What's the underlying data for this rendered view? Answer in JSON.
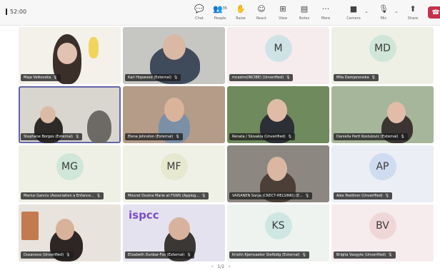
{
  "toolbar": {
    "timer": "52:00",
    "buttons": [
      {
        "label": "Chat",
        "icon": "chat-icon",
        "glyph": "💬"
      },
      {
        "label": "People",
        "icon": "people-icon",
        "glyph": "👥",
        "badge": "35"
      },
      {
        "label": "Raise",
        "icon": "raise-hand-icon",
        "glyph": "✋"
      },
      {
        "label": "React",
        "icon": "react-icon",
        "glyph": "☺"
      },
      {
        "label": "View",
        "icon": "view-icon",
        "glyph": "⊞"
      },
      {
        "label": "Notes",
        "icon": "notes-icon",
        "glyph": "▤"
      },
      {
        "label": "More",
        "icon": "more-icon",
        "glyph": "···"
      },
      {
        "label": "Camera",
        "icon": "camera-icon",
        "glyph": "■"
      },
      {
        "label": "Mic",
        "icon": "mic-muted-icon",
        "glyph": "🎙"
      },
      {
        "label": "Share",
        "icon": "share-icon",
        "glyph": "⬆"
      }
    ],
    "leave_glyph": "☎"
  },
  "participants": [
    {
      "name": "Maja Velkovska",
      "type": "video"
    },
    {
      "name": "Karl Hopwood (External)",
      "type": "video"
    },
    {
      "name": "mcastro(INCIBE) (Unverified)",
      "type": "avatar",
      "initials": "M",
      "bg": "#cfe3e6"
    },
    {
      "name": "Mila Damjanovska",
      "type": "avatar",
      "initials": "MD",
      "bg": "#cfe6d8"
    },
    {
      "name": "Stephane Borges (External)",
      "type": "video"
    },
    {
      "name": "Elena Johnston (External)",
      "type": "video"
    },
    {
      "name": "Renata / Slovakia (Unverified)",
      "type": "video"
    },
    {
      "name": "Daniella Pertl Kostulovic (External)",
      "type": "video"
    },
    {
      "name": "Marius Ganciu (Association a Enfance...",
      "type": "avatar",
      "initials": "MG",
      "bg": "#cfe6d8"
    },
    {
      "name": "Mourat Dusina Marie at FSWS (Applog...",
      "type": "avatar",
      "initials": "MF",
      "bg": "#e6e8cf"
    },
    {
      "name": "VAISANEN Sonja (CNECT-HELSINKI) (E...",
      "type": "video"
    },
    {
      "name": "Alex Poettner (Unverified)",
      "type": "avatar",
      "initials": "AP",
      "bg": "#cfdcef"
    },
    {
      "name": "Dusanova (Unverified)",
      "type": "video"
    },
    {
      "name": "Elizabeth Dunbar-Fox (External)",
      "type": "video",
      "logo": "ispcc"
    },
    {
      "name": "Kristin Kjemsaeter Stefbdig (External)",
      "type": "avatar",
      "initials": "KS",
      "bg": "#cfe6e3"
    },
    {
      "name": "Brigita Vazgyte (Unverified)",
      "type": "avatar",
      "initials": "BV",
      "bg": "#f0d7d7"
    }
  ],
  "pager": {
    "prev": "‹",
    "label": "1/2",
    "next": "›"
  }
}
